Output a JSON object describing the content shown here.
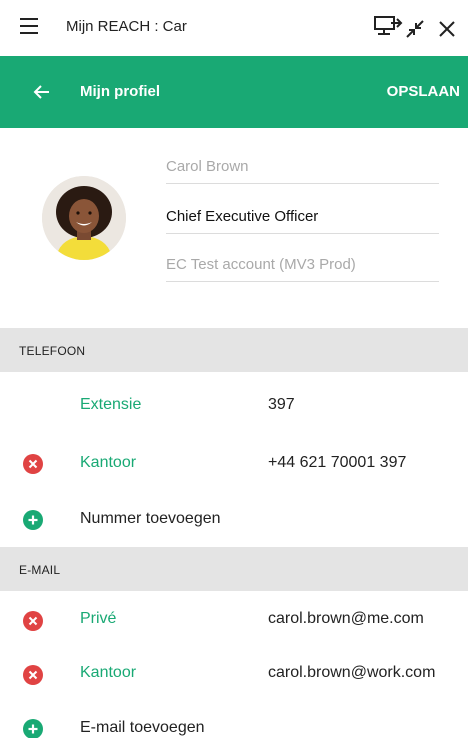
{
  "window": {
    "title": "Mijn REACH : Car"
  },
  "header": {
    "title": "Mijn profiel",
    "save_label": "OPSLAAN"
  },
  "profile": {
    "name_placeholder": "Carol Brown",
    "job_title": "Chief Executive Officer",
    "account_placeholder": "EC Test account (MV3 Prod)"
  },
  "phone": {
    "section_label": "TELEFOON",
    "rows": [
      {
        "label": "Extensie",
        "value": "397"
      },
      {
        "label": "Kantoor",
        "value": "+44 621 70001 397"
      }
    ],
    "add_label": "Nummer toevoegen"
  },
  "email": {
    "section_label": "E-MAIL",
    "rows": [
      {
        "label": "Privé",
        "value": "carol.brown@me.com"
      },
      {
        "label": "Kantoor",
        "value": "carol.brown@work.com"
      }
    ],
    "add_label": "E-mail toevoegen"
  },
  "colors": {
    "accent": "#19a974",
    "remove": "#e04343",
    "section_bg": "#e4e4e4"
  },
  "icons": [
    "hamburger-menu-icon",
    "screen-share-icon",
    "minimize-icon",
    "close-icon",
    "back-arrow-icon",
    "remove-icon",
    "add-icon"
  ]
}
